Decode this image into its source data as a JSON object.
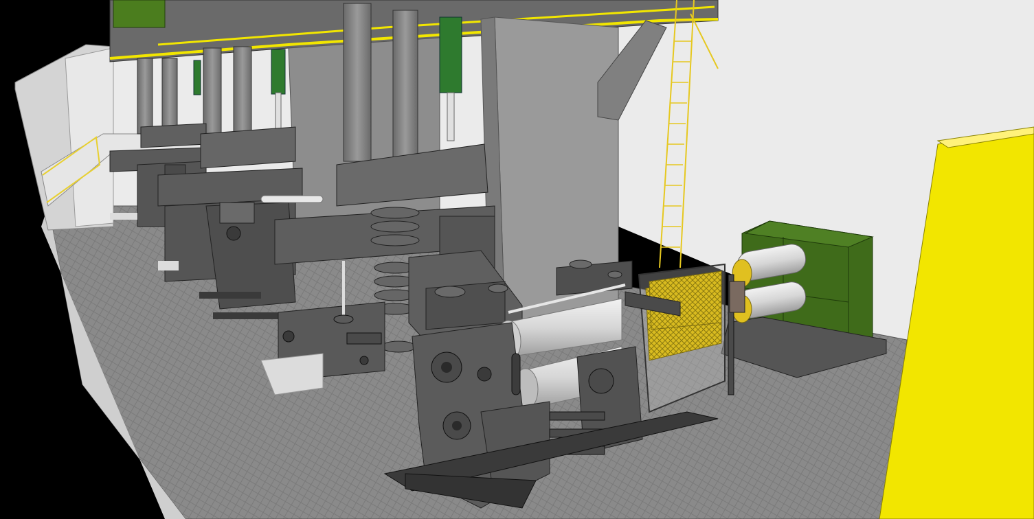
{
  "scene": {
    "kind": "3D CAD model of a rolling mill line",
    "colors": {
      "background_left": "#000000",
      "background_wall": "#ebebeb",
      "floor": "#8a8a8a",
      "floor_plate": "#dcdcdc",
      "machine_gray": "#595959",
      "machine_dark": "#3c3c3c",
      "column_gray": "#8c8c8c",
      "concrete": "#9a9a9a",
      "roll_white": "#d8d8d8",
      "safety_yellow": "#f2e600",
      "green_drive": "#3f6b1a",
      "cyl_green": "#2e7a2e",
      "mesh_yellow": "#e0c020"
    },
    "parts": [
      "mill-stand-front",
      "mill-stand-middle",
      "mill-stand-rear",
      "work-rolls",
      "gear-box-drive",
      "access-ladder",
      "hydraulic-cylinders",
      "upper-platform",
      "concrete-column",
      "yellow-cabinet",
      "guard-cage",
      "floor-checker-plate"
    ]
  }
}
